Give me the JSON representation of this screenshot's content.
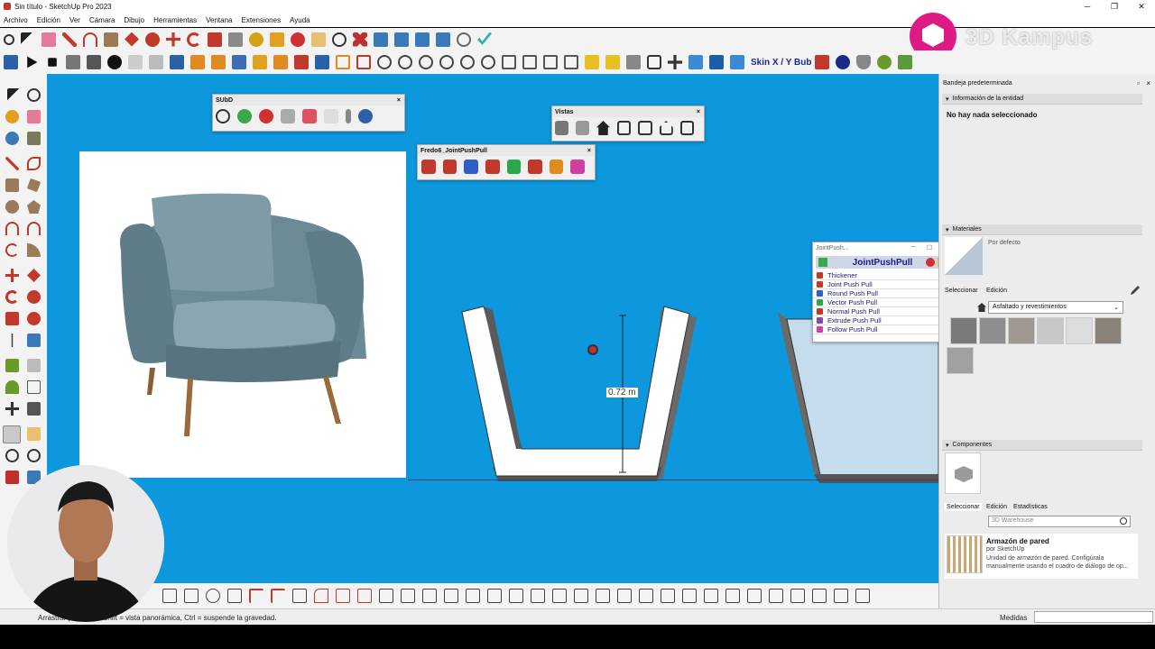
{
  "window": {
    "title": "Sin título - SketchUp Pro 2023",
    "minimize": "─",
    "restore": "❐",
    "close": "✕"
  },
  "menu": [
    "Archivo",
    "Edición",
    "Ver",
    "Cámara",
    "Dibujo",
    "Herramientas",
    "Ventana",
    "Extensiones",
    "Ayuda"
  ],
  "logo": {
    "text": "3D Kampus"
  },
  "toolbars": {
    "skin_label": "Skin X / Y Bub",
    "subd": {
      "title": "SUbD",
      "close": "×"
    },
    "vistas": {
      "title": "Vistas",
      "close": "×"
    },
    "fredo": {
      "title": "Fredo6_JointPushPull",
      "close": "×"
    }
  },
  "jpp_dialog": {
    "window_title": "JointPush...",
    "heading": "JointPushPull",
    "items": [
      {
        "label": "Thickener",
        "color": "#c0392b"
      },
      {
        "label": "Joint Push Pull",
        "color": "#c0392b"
      },
      {
        "label": "Round Push Pull",
        "color": "#2e5fc7"
      },
      {
        "label": "Vector Push Pull",
        "color": "#2aa84a"
      },
      {
        "label": "Normal Push Pull",
        "color": "#c0392b"
      },
      {
        "label": "Extrude Push Pull",
        "color": "#8e44ad"
      },
      {
        "label": "Follow Push Pull",
        "color": "#d03fa0"
      }
    ],
    "eye": "◉"
  },
  "viewport": {
    "dimension": "0.72 m"
  },
  "tray": {
    "title": "Bandeja predeterminada",
    "entity": {
      "header": "Información de la entidad",
      "empty": "No hay nada seleccionado"
    },
    "materials": {
      "header": "Materiales",
      "default": "Por defecto",
      "tab_select": "Seleccionar",
      "tab_edit": "Edición",
      "library": "Asfaltado y revestimientos"
    },
    "components": {
      "header": "Componentes",
      "tab_select": "Seleccionar",
      "tab_edit": "Edición",
      "tab_stats": "Estadísticas",
      "search_placeholder": "3D Warehouse",
      "item": {
        "name": "Armazón de pared",
        "author": "por SketchUp",
        "desc": "Unidad de armazón de pared. Configúrala manualmente usando el cuadro de diálogo de op..."
      }
    }
  },
  "status": {
    "text": "Arrastrar para rotar. Shift = vista panorámica, Ctrl = suspende la gravedad.",
    "measure_label": "Medidas"
  },
  "colors": {
    "viewport": "#0d97dc",
    "chrome": "#f3f3f3"
  }
}
